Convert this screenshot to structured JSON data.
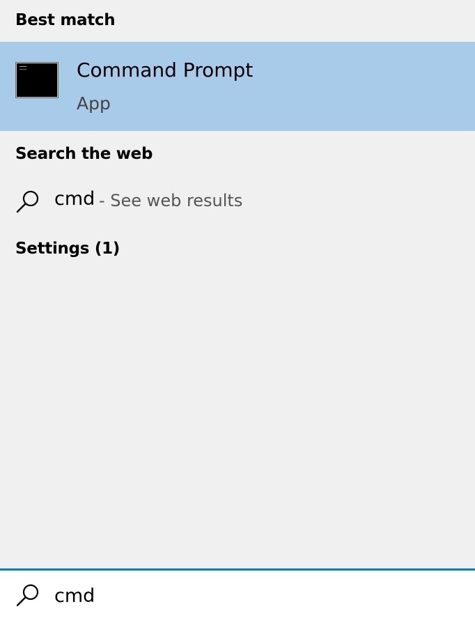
{
  "best_match": {
    "header": "Best match",
    "app_name": "Command Prompt",
    "app_type": "App",
    "icon": "command-prompt-icon"
  },
  "search_web": {
    "header": "Search the web",
    "query": "cmd",
    "suffix": "- See web results",
    "icon": "search-icon"
  },
  "settings": {
    "header": "Settings (1)"
  },
  "search_box": {
    "value": "cmd",
    "icon": "search-icon"
  },
  "colors": {
    "highlight": "#a9cbea",
    "panel_bg": "#f0f0f0",
    "accent": "#0078d7"
  }
}
